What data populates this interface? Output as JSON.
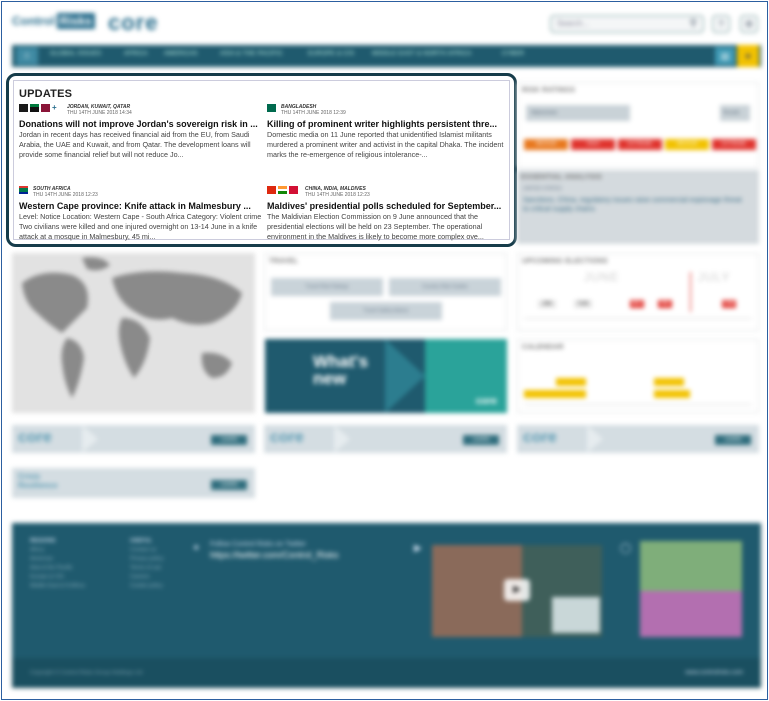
{
  "header": {
    "brand_left": "Control",
    "brand_left_box": "Risks",
    "brand_core": "core",
    "search_placeholder": "Search...",
    "search_icon": "search-icon",
    "help_icon": "question-icon",
    "settings_icon": "gear-icon"
  },
  "nav": {
    "home_icon": "home-icon",
    "items": [
      "GLOBAL ISSUES",
      "AFRICA",
      "AMERICAS",
      "ASIA & THE PACIFIC",
      "EUROPE & CIS",
      "MIDDLE EAST & NORTH AFRICA",
      "CYBER"
    ],
    "tools": [
      "chart-icon",
      "star-icon"
    ]
  },
  "updates": {
    "title": "UPDATES",
    "items": [
      {
        "country": "JORDAN, KUWAIT, QATAR",
        "date": "THU 14TH JUNE 2018  14:34",
        "title": "Donations will not improve Jordan's sovereign risk in ...",
        "body": "Jordan in recent days has received financial aid from the EU, from Saudi Arabia, the UAE and Kuwait, and from Qatar. The development loans will provide some financial relief but will not reduce Jo...",
        "flags": [
          "#1a1a1a",
          "#8a1538",
          "#2a7a3a"
        ]
      },
      {
        "country": "BANGLADESH",
        "date": "THU 14TH JUNE 2018  12:39",
        "title": "Killing of prominent writer highlights persistent thre...",
        "body": "Domestic media on 11 June reported that unidentified Islamist militants murdered a prominent writer and activist in the capital Dhaka. The incident marks the re-emergence of religious intolerance-...",
        "flags": [
          "#006a4e"
        ]
      },
      {
        "country": "SOUTH AFRICA",
        "date": "THU 14TH JUNE 2018  12:23",
        "title": "Western Cape province: Knife attack in Malmesbury ...",
        "body": "Level: Notice Location: Western Cape - South Africa Category: Violent crime Two civilians were killed and one injured overnight on 13-14 June in a knife attack at a mosque in Malmesbury, 45 mi...",
        "flags": [
          "#007a4d"
        ]
      },
      {
        "country": "CHINA, INDIA, MALDIVES",
        "date": "THU 14TH JUNE 2018  12:23",
        "title": "Maldives' presidential polls scheduled for September...",
        "body": "The Maldivian Election Commission on 9 June announced that the presidential elections will be held on 23 September. The operational environment in the Maldives is likely to become more complex ove...",
        "flags": [
          "#de2910",
          "#ff9933",
          "#d21034"
        ]
      }
    ]
  },
  "ratings": {
    "title": "RISK RATINGS",
    "select_value": "Afghanistan",
    "go_label": "Results",
    "boxes": [
      {
        "label": "MEDIUM",
        "color": "#e8781e"
      },
      {
        "label": "HIGH",
        "color": "#e0342e"
      },
      {
        "label": "EXTREME",
        "color": "#e0342e"
      },
      {
        "label": "MEDIUM",
        "color": "#f2c200"
      },
      {
        "label": "EXTREME",
        "color": "#e0342e"
      }
    ]
  },
  "essential": {
    "title": "ESSENTIAL ANALYSIS",
    "country": "UNITED STATES",
    "text": "Sanctions, China, regulatory issues raise commercial espionage threat to critical supply chains"
  },
  "travel": {
    "title": "TRAVEL",
    "buttons": [
      "Travel Risk Ratings",
      "Country Risk Guides",
      "Travel Safety Advice"
    ]
  },
  "whatsnew": {
    "line1": "What's",
    "line2": "new",
    "brand": "core"
  },
  "elections": {
    "title": "UPCOMING ELECTIONS",
    "months": [
      "JUNE",
      "JULY"
    ],
    "bars": [
      {
        "label": "ZIM",
        "color": "#e5e5e5"
      },
      {
        "label": "TUR",
        "color": "#e5e5e5"
      },
      {
        "label": "MEX",
        "color": "#e0342e"
      },
      {
        "label": "PAK",
        "color": "#e0342e"
      },
      {
        "label": "CAM",
        "color": "#e0342e"
      }
    ]
  },
  "calendar": {
    "title": "CALENDAR"
  },
  "banners": {
    "brand": "core",
    "button": "LEARN",
    "crisis_line1": "Crisis",
    "crisis_line2": "Resilience"
  },
  "footer": {
    "col1_title": "REGIONS",
    "col1_items": [
      "Africa",
      "Americas",
      "Asia & the Pacific",
      "Europe & CIS",
      "Middle East & N Africa"
    ],
    "col2_title": "USEFUL",
    "col2_items": [
      "Contact us",
      "Privacy policy",
      "Terms of use",
      "Careers",
      "Cookie policy"
    ],
    "twitter_label": "Follow Control Risks on Twitter",
    "twitter_url": "https://twitter.com/Control_Risks",
    "copyright": "Copyright © Control Risks Group Holdings Ltd",
    "site": "www.controlrisks.com"
  }
}
